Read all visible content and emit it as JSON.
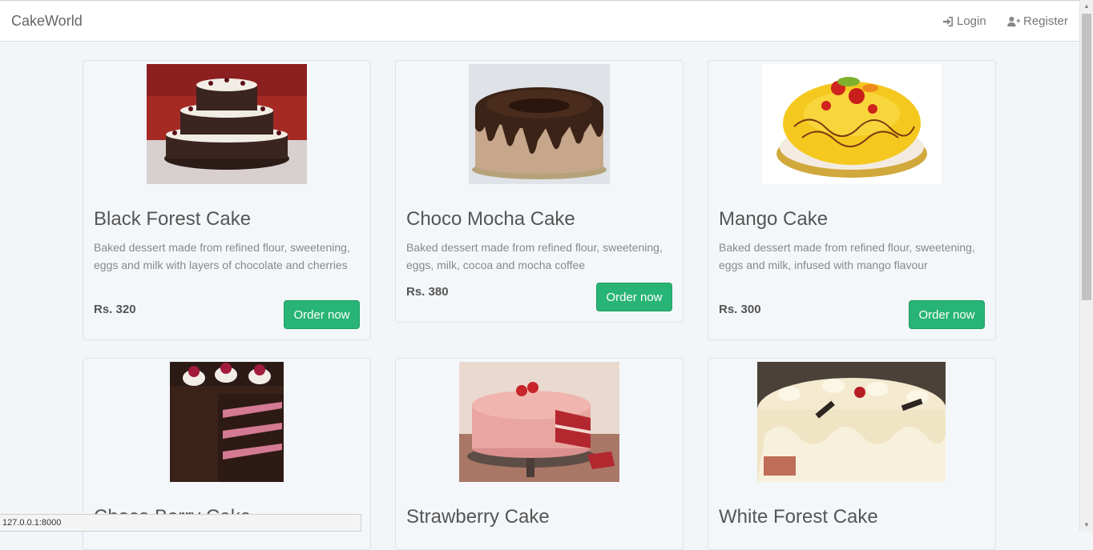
{
  "navbar": {
    "brand": "CakeWorld",
    "login_label": "Login",
    "register_label": "Register"
  },
  "status_bar": {
    "url": "127.0.0.1:8000"
  },
  "cakes": [
    {
      "title": "Black Forest Cake",
      "description": "Baked dessert made from refined flour, sweetening, eggs and milk with layers of chocolate and cherries",
      "price": "Rs. 320",
      "order_label": "Order now"
    },
    {
      "title": "Choco Mocha Cake",
      "description": "Baked dessert made from refined flour, sweetening, eggs, milk, cocoa and mocha coffee",
      "price": "Rs. 380",
      "order_label": "Order now"
    },
    {
      "title": "Mango Cake",
      "description": "Baked dessert made from refined flour, sweetening, eggs and milk, infused with mango flavour",
      "price": "Rs. 300",
      "order_label": "Order now"
    },
    {
      "title": "Choco Berry Cake"
    },
    {
      "title": "Strawberry Cake"
    },
    {
      "title": "White Forest Cake"
    }
  ],
  "colors": {
    "order_button": "#28b474",
    "page_background": "#f3f6f9"
  }
}
